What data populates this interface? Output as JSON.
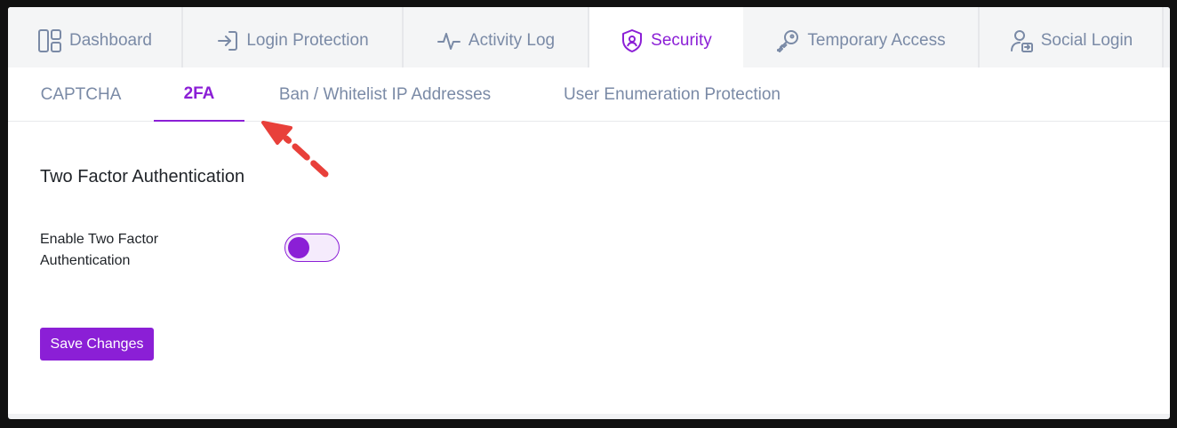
{
  "top_tabs": [
    {
      "label": "Dashboard",
      "icon": "dashboard-icon"
    },
    {
      "label": "Login Protection",
      "icon": "login-icon"
    },
    {
      "label": "Activity Log",
      "icon": "activity-icon"
    },
    {
      "label": "Security",
      "icon": "shield-icon",
      "active": true
    },
    {
      "label": "Temporary Access",
      "icon": "key-icon"
    },
    {
      "label": "Social Login",
      "icon": "user-login-icon"
    }
  ],
  "sub_tabs": [
    {
      "label": "CAPTCHA"
    },
    {
      "label": "2FA",
      "active": true
    },
    {
      "label": "Ban / Whitelist IP Addresses"
    },
    {
      "label": "User Enumeration Protection"
    }
  ],
  "section": {
    "title": "Two Factor Authentication",
    "toggle_label": "Enable Two Factor Authentication",
    "toggle_on": true
  },
  "actions": {
    "save_label": "Save Changes"
  },
  "colors": {
    "accent": "#8b1fd6",
    "inactive_text": "#7a8aa6",
    "annotation_arrow": "#e8403a"
  }
}
